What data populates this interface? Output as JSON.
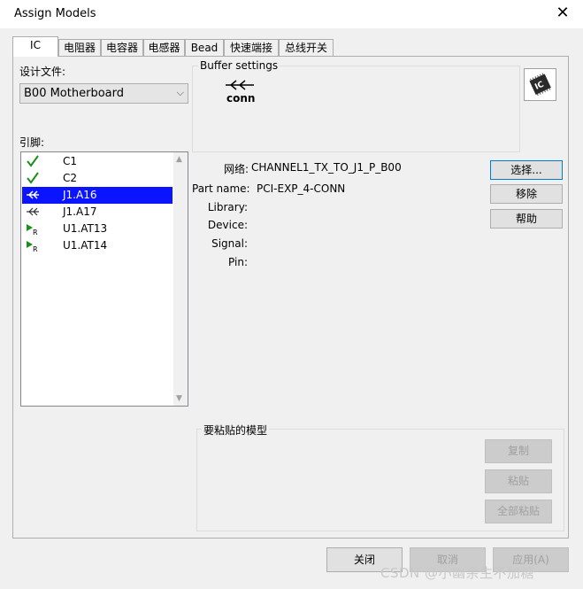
{
  "window": {
    "title": "Assign Models",
    "close_glyph": "✕"
  },
  "tabs": [
    {
      "label": "IC",
      "active": true
    },
    {
      "label": "电阻器"
    },
    {
      "label": "电容器"
    },
    {
      "label": "电感器"
    },
    {
      "label": "Bead"
    },
    {
      "label": "快速端接"
    },
    {
      "label": "总线开关"
    }
  ],
  "design_file": {
    "label": "设计文件:",
    "value": "B00 Motherboard"
  },
  "pins": {
    "label": "引脚:",
    "items": [
      {
        "label": "C1",
        "icon": "check-icon",
        "selected": false
      },
      {
        "label": "C2",
        "icon": "check-icon",
        "selected": false
      },
      {
        "label": "J1.A16",
        "icon": "connector-icon",
        "selected": true
      },
      {
        "label": "J1.A17",
        "icon": "connector-icon",
        "selected": false
      },
      {
        "label": "U1.AT13",
        "icon": "receiver-icon",
        "selected": false
      },
      {
        "label": "U1.AT14",
        "icon": "receiver-icon",
        "selected": false
      }
    ]
  },
  "buffer_settings": {
    "title": "Buffer settings",
    "icon_label": "conn"
  },
  "details": {
    "net_label": "网络:",
    "net_value": "CHANNEL1_TX_TO_J1_P_B00",
    "part_label": "Part name:",
    "part_value": "PCI-EXP_4-CONN",
    "library_label": "Library:",
    "device_label": "Device:",
    "signal_label": "Signal:",
    "pin_label": "Pin:"
  },
  "side_buttons": {
    "select": "选择...",
    "remove": "移除",
    "help": "帮助"
  },
  "paste_model": {
    "title": "要粘贴的模型",
    "copy": "复制",
    "paste": "粘贴",
    "paste_all": "全部粘贴"
  },
  "footer": {
    "close": "关闭",
    "cancel": "取消",
    "apply": "应用(A)"
  },
  "watermark": "CSDN @小幽余生不加糖",
  "colors": {
    "selection": "#0a14ff",
    "check_green": "#1a8f1a"
  }
}
